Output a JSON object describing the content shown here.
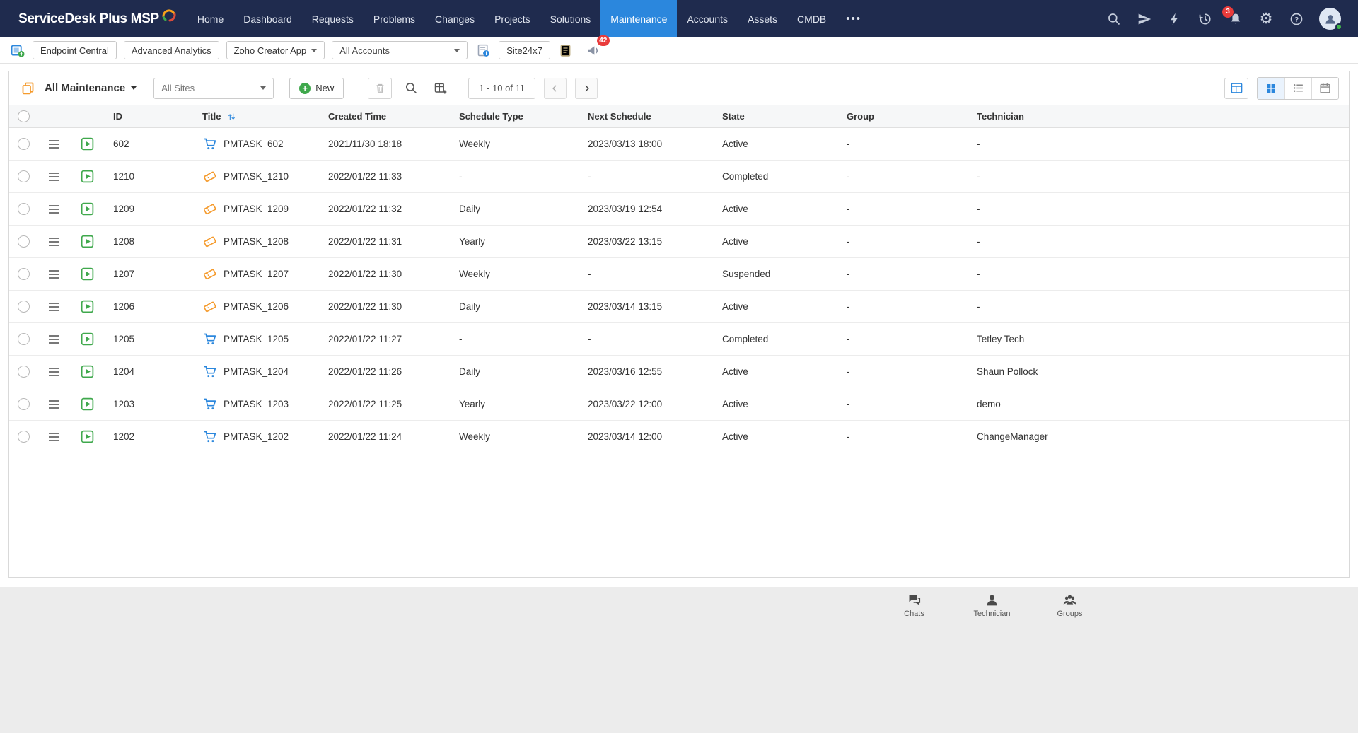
{
  "navbar": {
    "brand": "ServiceDesk Plus MSP",
    "items": [
      {
        "label": "Home",
        "active": false
      },
      {
        "label": "Dashboard",
        "active": false
      },
      {
        "label": "Requests",
        "active": false
      },
      {
        "label": "Problems",
        "active": false
      },
      {
        "label": "Changes",
        "active": false
      },
      {
        "label": "Projects",
        "active": false
      },
      {
        "label": "Solutions",
        "active": false
      },
      {
        "label": "Maintenance",
        "active": true
      },
      {
        "label": "Accounts",
        "active": false
      },
      {
        "label": "Assets",
        "active": false
      },
      {
        "label": "CMDB",
        "active": false
      }
    ],
    "more_label": "•••",
    "notification_badge": "3"
  },
  "toolbar": {
    "endpoint_central": "Endpoint Central",
    "advanced_analytics": "Advanced Analytics",
    "zoho_creator_app": "Zoho Creator App",
    "accounts_dropdown": "All Accounts",
    "site24x7": "Site24x7",
    "announcement_badge": "42"
  },
  "list_toolbar": {
    "title": "All Maintenance",
    "sites_dropdown": "All Sites",
    "new_button": "New",
    "pagination": "1 - 10 of 11"
  },
  "table": {
    "columns": [
      "ID",
      "Title",
      "Created Time",
      "Schedule Type",
      "Next Schedule",
      "State",
      "Group",
      "Technician"
    ],
    "rows": [
      {
        "id": "602",
        "icon": "cart",
        "title": "PMTASK_602",
        "created": "2021/11/30 18:18",
        "schedule_type": "Weekly",
        "next_schedule": "2023/03/13 18:00",
        "state": "Active",
        "group": "-",
        "technician": "-"
      },
      {
        "id": "1210",
        "icon": "ticket",
        "title": "PMTASK_1210",
        "created": "2022/01/22 11:33",
        "schedule_type": "-",
        "next_schedule": "-",
        "state": "Completed",
        "group": "-",
        "technician": "-"
      },
      {
        "id": "1209",
        "icon": "ticket",
        "title": "PMTASK_1209",
        "created": "2022/01/22 11:32",
        "schedule_type": "Daily",
        "next_schedule": "2023/03/19 12:54",
        "state": "Active",
        "group": "-",
        "technician": "-"
      },
      {
        "id": "1208",
        "icon": "ticket",
        "title": "PMTASK_1208",
        "created": "2022/01/22 11:31",
        "schedule_type": "Yearly",
        "next_schedule": "2023/03/22 13:15",
        "state": "Active",
        "group": "-",
        "technician": "-"
      },
      {
        "id": "1207",
        "icon": "ticket",
        "title": "PMTASK_1207",
        "created": "2022/01/22 11:30",
        "schedule_type": "Weekly",
        "next_schedule": "-",
        "state": "Suspended",
        "group": "-",
        "technician": "-"
      },
      {
        "id": "1206",
        "icon": "ticket",
        "title": "PMTASK_1206",
        "created": "2022/01/22 11:30",
        "schedule_type": "Daily",
        "next_schedule": "2023/03/14 13:15",
        "state": "Active",
        "group": "-",
        "technician": "-"
      },
      {
        "id": "1205",
        "icon": "cart",
        "title": "PMTASK_1205",
        "created": "2022/01/22 11:27",
        "schedule_type": "-",
        "next_schedule": "-",
        "state": "Completed",
        "group": "-",
        "technician": "Tetley Tech"
      },
      {
        "id": "1204",
        "icon": "cart",
        "title": "PMTASK_1204",
        "created": "2022/01/22 11:26",
        "schedule_type": "Daily",
        "next_schedule": "2023/03/16 12:55",
        "state": "Active",
        "group": "-",
        "technician": "Shaun Pollock"
      },
      {
        "id": "1203",
        "icon": "cart",
        "title": "PMTASK_1203",
        "created": "2022/01/22 11:25",
        "schedule_type": "Yearly",
        "next_schedule": "2023/03/22 12:00",
        "state": "Active",
        "group": "-",
        "technician": "demo"
      },
      {
        "id": "1202",
        "icon": "cart",
        "title": "PMTASK_1202",
        "created": "2022/01/22 11:24",
        "schedule_type": "Weekly",
        "next_schedule": "2023/03/14 12:00",
        "state": "Active",
        "group": "-",
        "technician": "ChangeManager"
      }
    ]
  },
  "footer": {
    "items": [
      "Chats",
      "Technician",
      "Groups"
    ]
  },
  "colors": {
    "accent": "#2b87dd",
    "green": "#3fa84c",
    "orange": "#f59b2d",
    "red": "#e93b3b",
    "navbar": "#1f2b4e"
  }
}
